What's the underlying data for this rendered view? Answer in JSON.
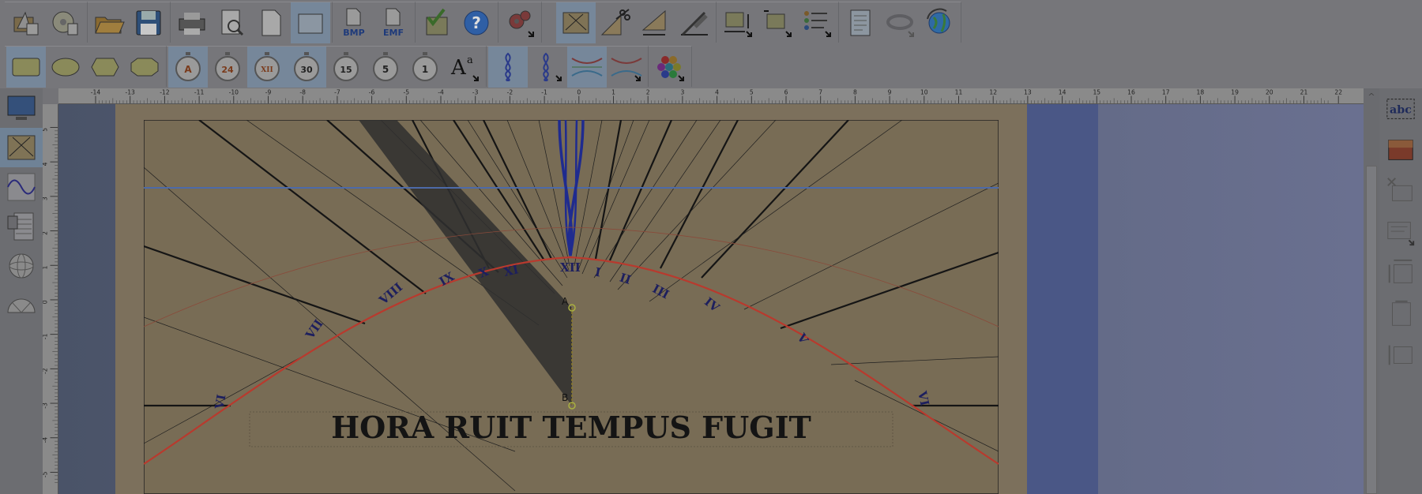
{
  "colors": {
    "accent_active": "#76879a",
    "dial_face": "#7c705c",
    "hour_line": "#1a1a1a",
    "date_curve": "#b83a2e",
    "horizon_line": "#4d6aa8",
    "noon_curve": "#1f2b8f",
    "shadow": "#2f2f2f"
  },
  "toolbar_top": {
    "groups": [
      [
        "new-sundial-icon",
        "wizard-disc-icon"
      ],
      [
        "open-folder-icon",
        "save-disk-icon"
      ],
      [
        "printer-icon",
        "print-preview-icon",
        "page-icon",
        "frame-icon"
      ],
      [
        "export-bmp-icon",
        "export-emf-icon"
      ],
      [
        "calculator-check-icon",
        "help-icon"
      ],
      [
        "gears-icon"
      ],
      [
        "dial-view-icon",
        "scissors-triangle-icon",
        "ruler-triangle-icon",
        "gnomon-edit-icon"
      ],
      [
        "rectangle-width-icon",
        "rectangle-move-icon",
        "list-bullets-icon"
      ],
      [
        "report-icon",
        "rotate-3d-icon",
        "globe-icon"
      ]
    ],
    "labels": {
      "bmp": "BMP",
      "emf": "EMF"
    }
  },
  "toolbar_bottom": {
    "shapes": [
      "rectangle-frame-icon",
      "ellipse-frame-icon",
      "hexagon-frame-icon",
      "octagon-frame-icon"
    ],
    "stopwatch_labels": [
      "A",
      "24",
      "XII",
      "30",
      "15",
      "5",
      "1"
    ],
    "font_label": "A",
    "font_super": "a"
  },
  "left_panel": [
    "monitor-icon",
    "dial-layout-icon",
    "sine-wave-icon",
    "table-calc-icon",
    "sphere-icon",
    "protractor-icon"
  ],
  "right_panel": {
    "text_tool": "abc",
    "items": [
      "text-box-icon",
      "image-icon",
      "delete-box-icon",
      "align-box-icon",
      "resize-vertical-icon",
      "box-height-icon",
      "spacing-icon"
    ]
  },
  "ruler": {
    "top_labels": [
      "-14",
      "-13",
      "-12",
      "-11",
      "-10",
      "-9",
      "-8",
      "-7",
      "-6",
      "-5",
      "-4",
      "-3",
      "-2",
      "-1",
      "0",
      "1",
      "2",
      "3",
      "4",
      "5",
      "6",
      "7",
      "8",
      "9",
      "10",
      "11",
      "12",
      "13",
      "14",
      "15",
      "16",
      "17",
      "18",
      "19",
      "20",
      "21",
      "22"
    ],
    "left_labels": [
      "5",
      "4",
      "3",
      "2",
      "1",
      "0",
      "-1",
      "-2",
      "-3",
      "-4",
      "-5"
    ]
  },
  "dial": {
    "motto": "HORA RUIT TEMPUS FUGIT",
    "point_a": "A",
    "point_b": "B",
    "hour_numerals": [
      "VI",
      "VII",
      "VIII",
      "IX",
      "X",
      "XI",
      "XII",
      "I",
      "II",
      "III",
      "IV",
      "V",
      "VI"
    ]
  }
}
